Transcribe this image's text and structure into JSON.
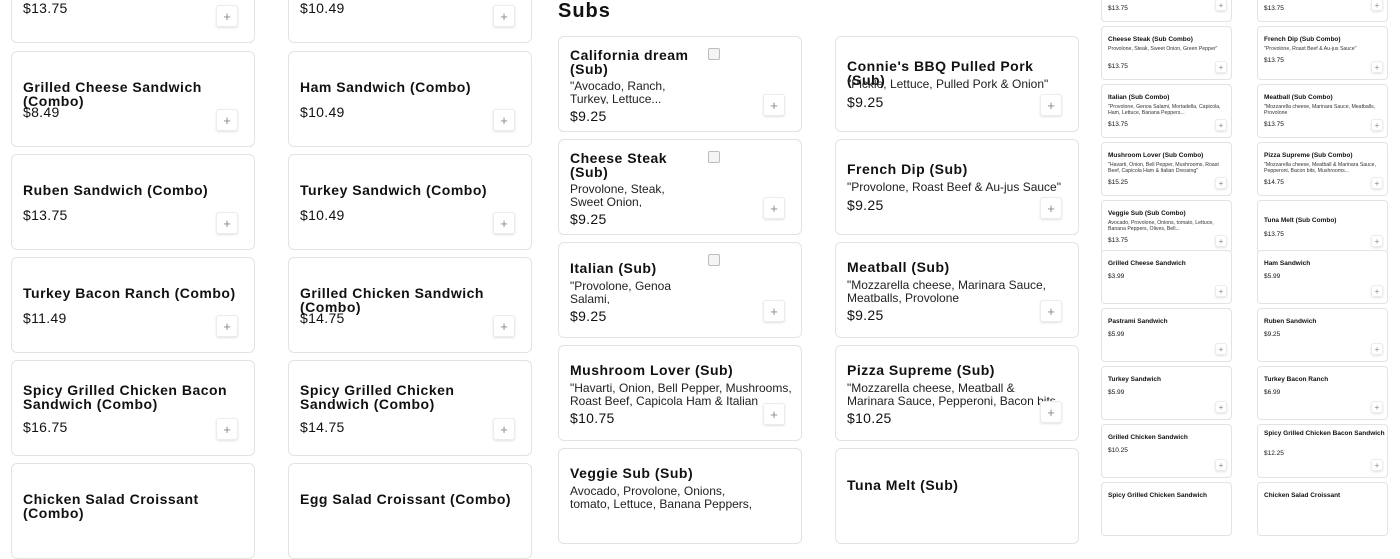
{
  "combos_left": [
    {
      "price": "$13.75"
    },
    {
      "name": "Grilled Cheese Sandwich (Combo)",
      "price": "$8.49"
    },
    {
      "name": "Ruben Sandwich (Combo)",
      "price": "$13.75"
    },
    {
      "name": "Turkey Bacon Ranch (Combo)",
      "price": "$11.49"
    },
    {
      "name": "Spicy Grilled Chicken Bacon Sandwich (Combo)",
      "price": "$16.75"
    },
    {
      "name": "Chicken Salad Croissant (Combo)"
    }
  ],
  "combos_mid": [
    {
      "price": "$10.49"
    },
    {
      "name": "Ham Sandwich (Combo)",
      "price": "$10.49"
    },
    {
      "name": "Turkey Sandwich (Combo)",
      "price": "$10.49"
    },
    {
      "name": "Grilled Chicken Sandwich (Combo)",
      "price": "$14.75"
    },
    {
      "name": "Spicy Grilled Chicken Sandwich (Combo)",
      "price": "$14.75"
    },
    {
      "name": "Egg Salad Croissant (Combo)"
    }
  ],
  "subs_heading": "Subs",
  "subs_left": [
    {
      "name": "California dream (Sub)",
      "desc": "\"Avocado, Ranch, Turkey, Lettuce...",
      "price": "$9.25"
    },
    {
      "name": "Cheese Steak (Sub)",
      "desc": "Provolone, Steak, Sweet Onion, Green...",
      "price": "$9.25"
    },
    {
      "name": "Italian (Sub)",
      "desc": "\"Provolone, Genoa Salami, Mortadella,...",
      "price": "$9.25"
    },
    {
      "name": "Mushroom Lover (Sub)",
      "desc": "\"Havarti, Onion, Bell Pepper, Mushrooms, Roast Beef, Capicola Ham & Italian Dressing\"",
      "price": "$10.75"
    },
    {
      "name": "Veggie Sub (Sub)",
      "desc": "Avocado, Provolone, Onions, tomato, Lettuce, Banana Peppers, Olives, Bell..."
    }
  ],
  "subs_right": [
    {
      "name": "Connie's BBQ Pulled Pork (Sub)",
      "desc": "\"Pickle, Lettuce, Pulled Pork & Onion\"",
      "price": "$9.25"
    },
    {
      "name": "French Dip (Sub)",
      "desc": "\"Provolone, Roast Beef & Au-jus Sauce\"",
      "price": "$9.25"
    },
    {
      "name": "Meatball (Sub)",
      "desc": "\"Mozzarella cheese, Marinara Sauce, Meatballs, Provolone",
      "price": "$9.25"
    },
    {
      "name": "Pizza Supreme (Sub)",
      "desc": "\"Mozzarella cheese, Meatball & Marinara Sauce, Pepperoni, Bacon bits, Mushrooms,...",
      "price": "$10.25"
    },
    {
      "name": "Tuna Melt (Sub)"
    }
  ],
  "mini_left": [
    {
      "price": "$13.75"
    },
    {
      "name": "Cheese Steak (Sub Combo)",
      "desc": "Provolone, Steak, Sweet Onion, Green Pepper\"",
      "price": "$13.75"
    },
    {
      "name": "Italian (Sub Combo)",
      "desc": "\"Provolone, Genoa Salami, Mortadella, Capicola, Ham, Lettuce, Banana Peppers...",
      "price": "$13.75"
    },
    {
      "name": "Mushroom Lover (Sub Combo)",
      "desc": "\"Havarti, Onion, Bell Pepper, Mushrooms, Roast Beef, Capicola Ham & Italian Dressing\"",
      "price": "$15.25"
    },
    {
      "name": "Veggie Sub (Sub Combo)",
      "desc": "Avocado, Provolone, Onions, tomato, Lettuce, Banana Peppers, Olives, Bell...",
      "price": "$13.75"
    },
    {
      "name": "Grilled Cheese Sandwich",
      "price": "$3.99"
    },
    {
      "name": "Pastrami Sandwich",
      "price": "$5.99"
    },
    {
      "name": "Turkey Sandwich",
      "price": "$5.99"
    },
    {
      "name": "Grilled Chicken Sandwich",
      "price": "$10.25"
    },
    {
      "name": "Spicy Grilled Chicken Sandwich"
    }
  ],
  "mini_right": [
    {
      "price": "$13.75"
    },
    {
      "name": "French Dip (Sub Combo)",
      "desc": "\"Provolone, Roast Beef & Au-jus Sauce\"",
      "price": "$13.75"
    },
    {
      "name": "Meatball (Sub Combo)",
      "desc": "\"Mozzarella cheese, Marinara Sauce, Meatballs, Provolone",
      "price": "$13.75"
    },
    {
      "name": "Pizza Supreme (Sub Combo)",
      "desc": "\"Mozzarella cheese, Meatball & Marinara Sauce, Pepperoni, Bacon bits, Mushrooms...",
      "price": "$14.75"
    },
    {
      "name": "Tuna Melt (Sub Combo)",
      "price": "$13.75"
    },
    {
      "name": "Ham Sandwich",
      "price": "$5.99"
    },
    {
      "name": "Ruben Sandwich",
      "price": "$9.25"
    },
    {
      "name": "Turkey Bacon Ranch",
      "price": "$6.99"
    },
    {
      "name": "Spicy Grilled Chicken Bacon Sandwich",
      "price": "$12.25"
    },
    {
      "name": "Chicken Salad Croissant"
    }
  ],
  "icons": {
    "add": "+",
    "image": "broken-image-icon"
  }
}
